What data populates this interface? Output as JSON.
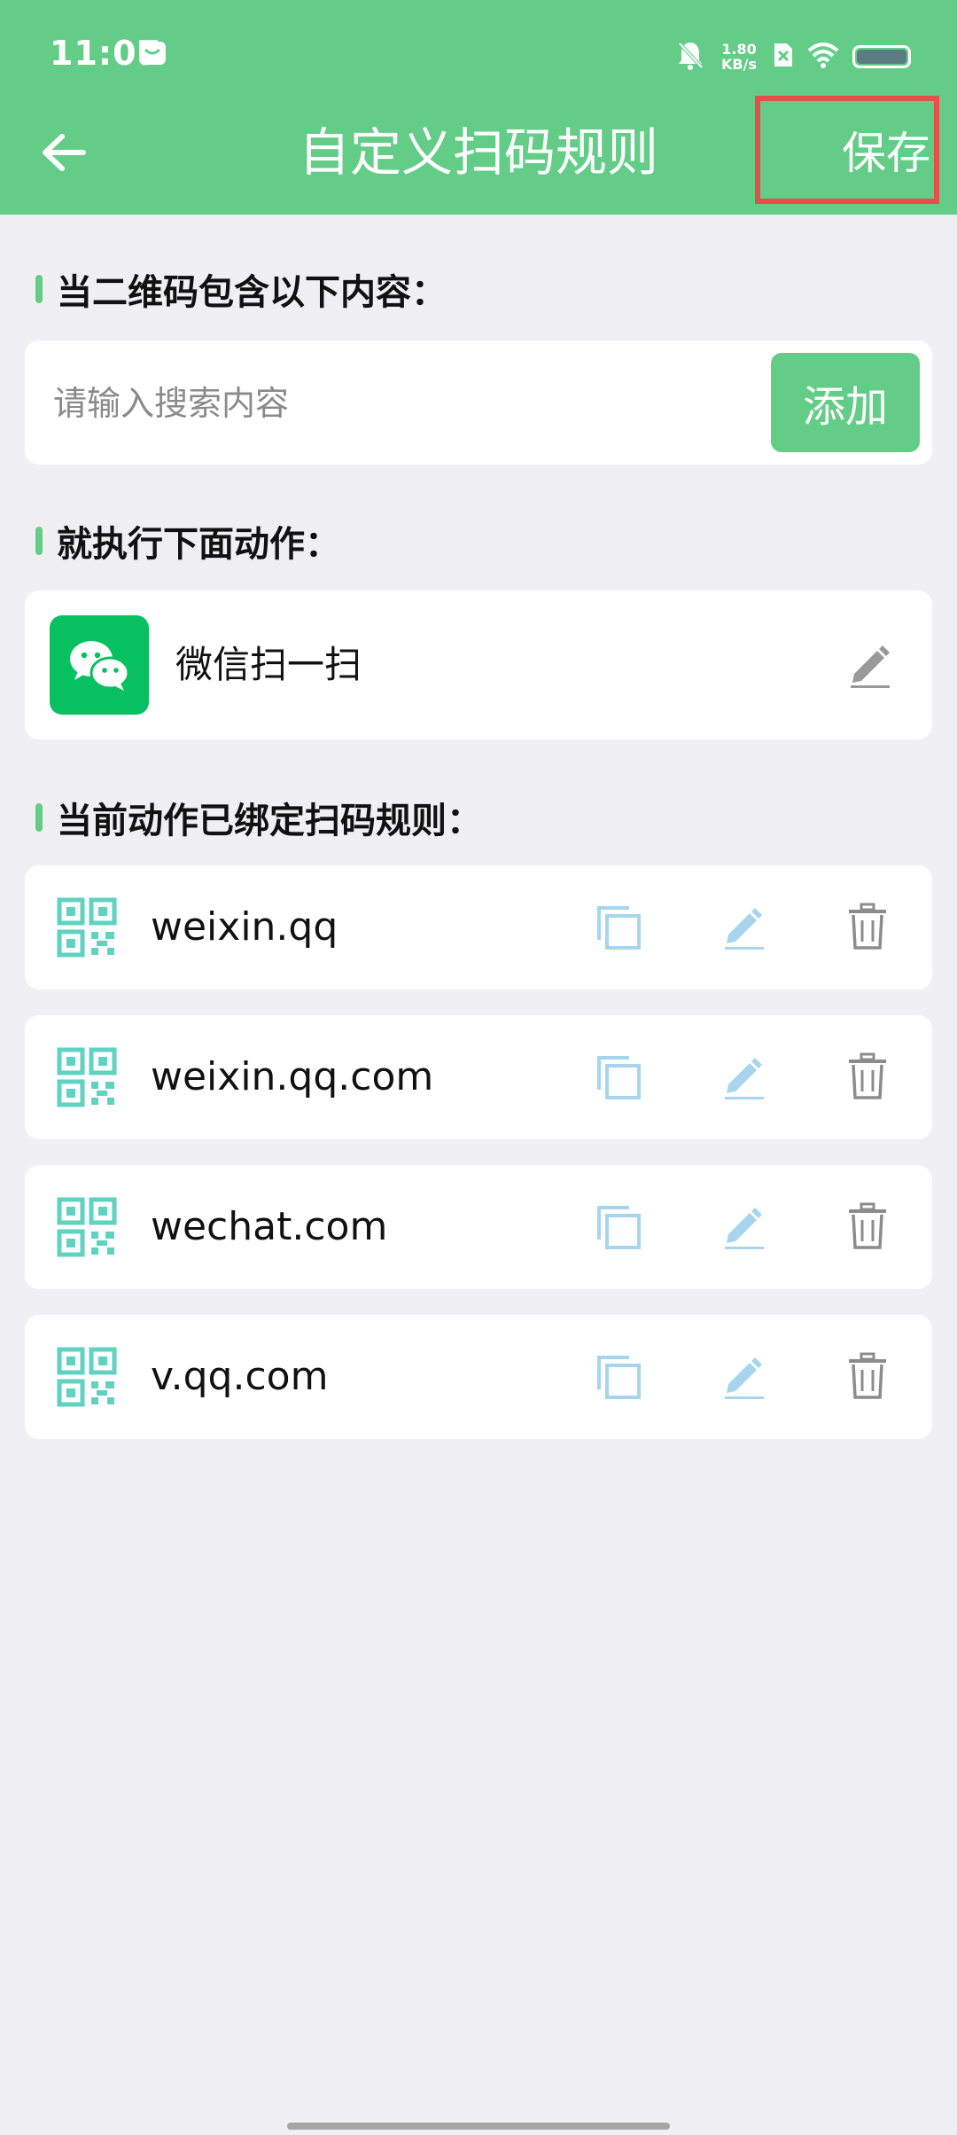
{
  "status_bar": {
    "time": "11:07",
    "net_speed_value": "1.80",
    "net_speed_unit": "KB/s",
    "icons": [
      "notification-icon",
      "mute-bell-icon",
      "no-sim-icon",
      "wifi-icon",
      "battery-icon"
    ]
  },
  "header": {
    "title": "自定义扫码规则",
    "save_label": "保存",
    "back_icon": "arrow-left-icon"
  },
  "section_contains": {
    "heading": "当二维码包含以下内容："
  },
  "search": {
    "placeholder": "请输入搜索内容",
    "value": "",
    "add_label": "添加"
  },
  "section_action": {
    "heading": "就执行下面动作："
  },
  "action": {
    "label": "微信扫一扫",
    "icon": "wechat-icon"
  },
  "section_rules": {
    "heading": "当前动作已绑定扫码规则："
  },
  "rules": [
    {
      "text": "weixin.qq"
    },
    {
      "text": "weixin.qq.com"
    },
    {
      "text": "wechat.com"
    },
    {
      "text": "v.qq.com"
    }
  ],
  "colors": {
    "brand_green": "#63cd87",
    "wechat_green": "#07c160",
    "highlight_red": "#e44f4a",
    "qr_teal": "#5fd3bf",
    "copy_edit_blue": "#a7d5ee",
    "delete_gray": "#8c8c8c",
    "background": "#f0f0f2"
  }
}
